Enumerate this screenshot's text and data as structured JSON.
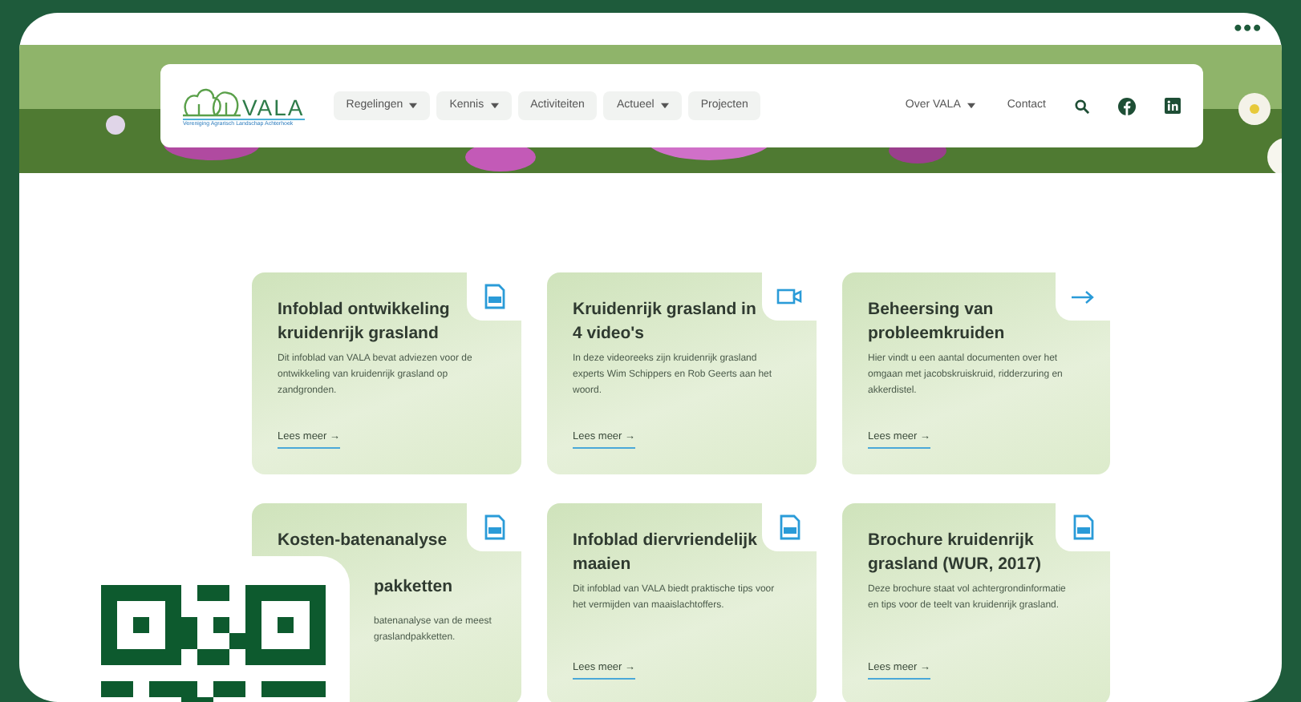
{
  "window": {
    "menu": "•••"
  },
  "logo": {
    "name": "VALA",
    "tagline": "Vereniging Agrarisch Landschap Achterhoek"
  },
  "nav": [
    {
      "label": "Regelingen",
      "dropdown": true
    },
    {
      "label": "Kennis",
      "dropdown": true
    },
    {
      "label": "Activiteiten",
      "dropdown": false
    },
    {
      "label": "Actueel",
      "dropdown": true
    },
    {
      "label": "Projecten",
      "dropdown": false
    }
  ],
  "nav_right": [
    {
      "label": "Over VALA",
      "dropdown": true
    },
    {
      "label": "Contact",
      "dropdown": false
    }
  ],
  "cards": [
    {
      "kind": "document",
      "title": "Infoblad ontwikkeling kruidenrijk grasland",
      "text": "Dit infoblad van VALA bevat adviezen voor de ontwikkeling van kruidenrijk grasland op zandgronden.",
      "link": "Lees meer →"
    },
    {
      "kind": "video",
      "title": "Kruidenrijk grasland in 4 video's",
      "text": "In deze videoreeks zijn kruidenrijk grasland experts Wim Schippers en Rob Geerts aan het woord.",
      "link": "Lees meer →"
    },
    {
      "kind": "page",
      "title": "Beheersing van probleemkruiden",
      "text": "Hier vindt u een aantal documenten over het omgaan met jacobskruiskruid, ridderzuring en akkerdistel.",
      "link": "Lees meer →"
    },
    {
      "kind": "document",
      "title": "Kosten-batenanalyse",
      "title_tail": "pakketten",
      "text_tail": [
        "batenanalyse van de meest",
        "graslandpakketten."
      ]
    },
    {
      "kind": "document",
      "title": "Infoblad diervriendelijk maaien",
      "text": "Dit infoblad van VALA biedt praktische tips voor het vermijden van maaislachtoffers.",
      "link": "Lees meer →"
    },
    {
      "kind": "document",
      "title": "Brochure kruidenrijk grasland (WUR, 2017)",
      "text": "Deze brochure staat vol achtergrondinformatie en tips voor de teelt van kruidenrijk grasland.",
      "link": "Lees meer →"
    }
  ]
}
